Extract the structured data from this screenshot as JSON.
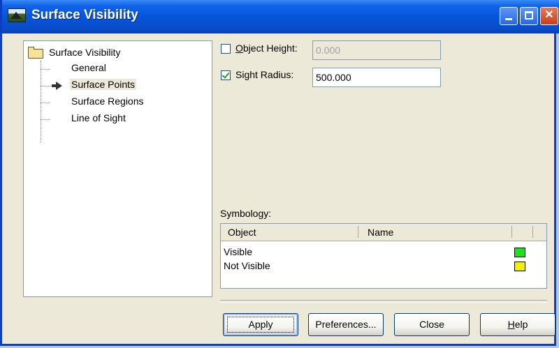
{
  "window": {
    "title": "Surface Visibility",
    "titlebar_color": "#0a54d8"
  },
  "tree": {
    "root_label": "Surface Visibility",
    "items": [
      {
        "label": "General"
      },
      {
        "label": "Surface Points",
        "selected": true
      },
      {
        "label": "Surface Regions"
      },
      {
        "label": "Line of Sight"
      }
    ]
  },
  "form": {
    "object_height": {
      "label_u": "O",
      "label_rest": "bject Height:",
      "checked": false,
      "value": "0.000",
      "disabled": true
    },
    "sight_radius": {
      "label": "Sight Radius:",
      "checked": true,
      "value": "500.000"
    }
  },
  "symbology": {
    "label": "Symbology:",
    "columns": [
      "Object",
      "Name"
    ],
    "rows": [
      {
        "object": "Visible",
        "name": "",
        "color": "#22dd22"
      },
      {
        "object": "Not Visible",
        "name": "",
        "color": "#f2f200"
      }
    ]
  },
  "buttons": {
    "apply": "Apply",
    "preferences": "Preferences...",
    "close": "Close",
    "help_u": "H",
    "help_rest": "elp"
  }
}
